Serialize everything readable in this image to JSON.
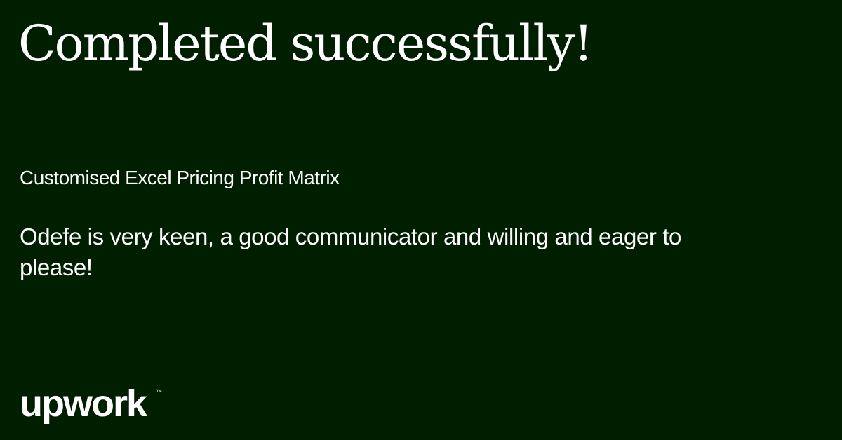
{
  "headline": "Completed successfully!",
  "project_title": "Customised Excel Pricing Profit Matrix",
  "feedback": "Odefe is very keen, a good communicator and willing and eager to please!",
  "brand": {
    "logo_text": "upwork",
    "trademark": "™"
  },
  "colors": {
    "background": "#001e00",
    "text": "#ffffff"
  }
}
